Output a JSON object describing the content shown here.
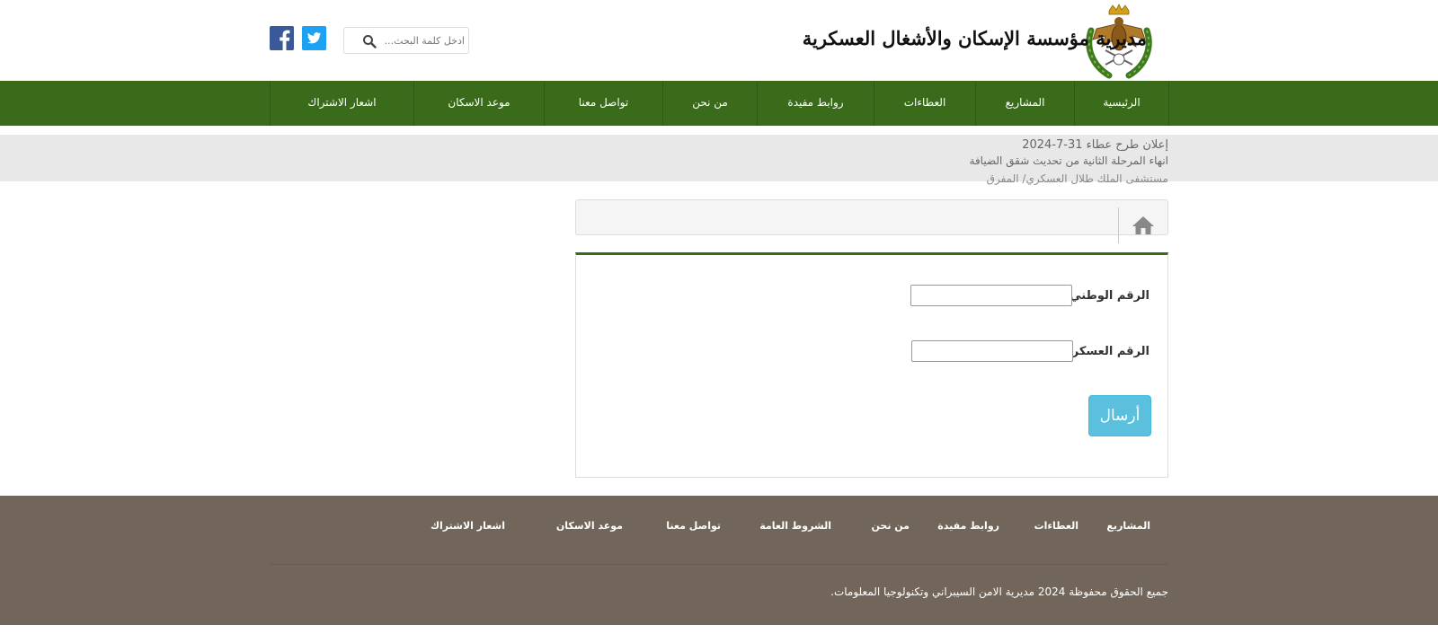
{
  "header": {
    "site_title": "مديرية مؤسسة الإسكان والأشغال العسكرية",
    "search_placeholder": "ادخل كلمة البحث...",
    "logo_icon": "royal-eagle-emblem-icon",
    "social": [
      "facebook-icon",
      "twitter-icon"
    ]
  },
  "nav": {
    "items": [
      {
        "label": "الرئيسية"
      },
      {
        "label": "المشاريع"
      },
      {
        "label": "العطاءات"
      },
      {
        "label": "روابط مفيدة"
      },
      {
        "label": "من نحن"
      },
      {
        "label": "تواصل معنا"
      },
      {
        "label": "موعد الاسكان"
      },
      {
        "label": "اشعار الاشتراك"
      }
    ]
  },
  "ticker": {
    "lines": [
      "إعلان طرح عطاء 31-7-2024",
      "انهاء المرحلة الثانية من تحديث شقق الضيافة",
      "مستشفى الملك طلال العسكري/ المفرق"
    ]
  },
  "breadcrumb": {
    "home_icon": "home-icon"
  },
  "form": {
    "national_id_label": "الرقم الوطني:",
    "military_id_label": "الرقم العسكري:",
    "national_id_value": "",
    "military_id_value": "",
    "submit_label": "أرسال"
  },
  "footer": {
    "links": [
      {
        "label": "المشاريع"
      },
      {
        "label": "العطاءات"
      },
      {
        "label": "روابط مفيدة"
      },
      {
        "label": "من نحن"
      },
      {
        "label": "الشروط العامة"
      },
      {
        "label": "تواصل معنا"
      },
      {
        "label": "موعد الاسكان"
      },
      {
        "label": "اشعار الاشتراك"
      }
    ],
    "copyright": "جميع الحقوق محفوظة 2024 مديرية الامن السيبراني وتكنولوجيا المعلومات."
  },
  "colors": {
    "nav_green": "#3a6b1a",
    "footer_brown": "#716659",
    "button_blue": "#5bc0de",
    "ticker_gray": "#e8e8e8"
  }
}
